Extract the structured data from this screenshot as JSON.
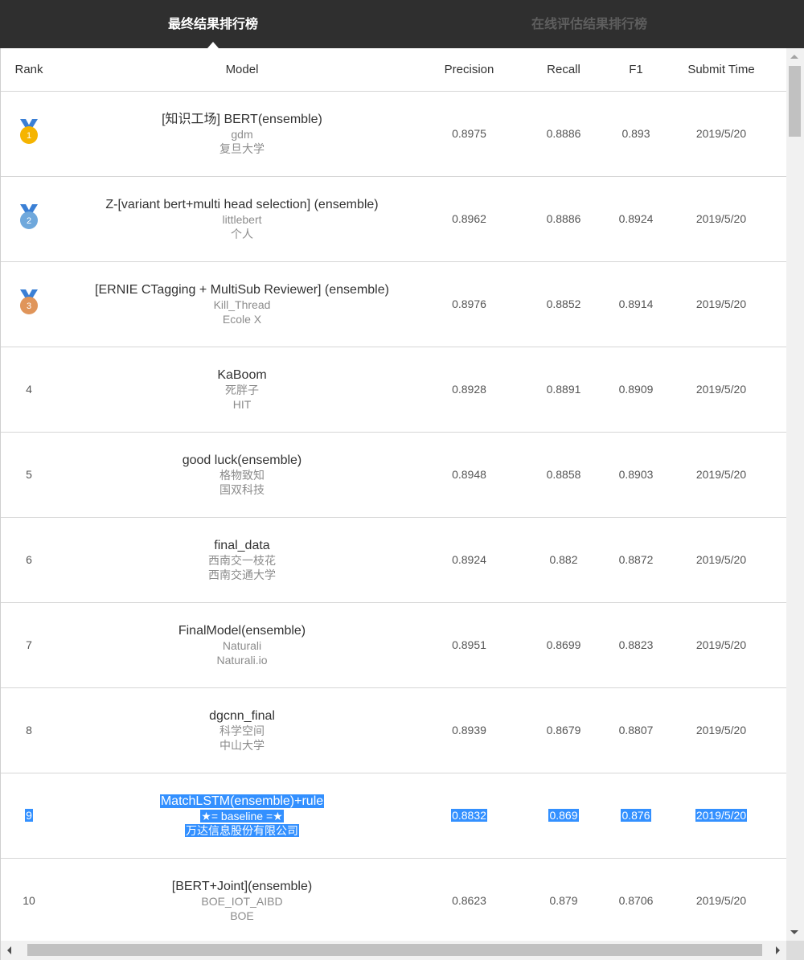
{
  "tabs": {
    "active": "最终结果排行榜",
    "inactive": "在线评估结果排行榜"
  },
  "columns": {
    "rank": "Rank",
    "model": "Model",
    "precision": "Precision",
    "recall": "Recall",
    "f1": "F1",
    "submit_time": "Submit Time"
  },
  "medal_colors": {
    "gold": "#f5b400",
    "silver": "#6fa8dc",
    "bronze": "#e0955a",
    "ribbon": "#3a7fd5"
  },
  "rows": [
    {
      "rank": "1",
      "medal": "gold",
      "model": "[知识工场] BERT(ensemble)",
      "team": "gdm",
      "org": "复旦大学",
      "precision": "0.8975",
      "recall": "0.8886",
      "f1": "0.893",
      "time": "2019/5/20"
    },
    {
      "rank": "2",
      "medal": "silver",
      "model": "Z-[variant bert+multi head selection] (ensemble)",
      "team": "littlebert",
      "org": "个人",
      "precision": "0.8962",
      "recall": "0.8886",
      "f1": "0.8924",
      "time": "2019/5/20"
    },
    {
      "rank": "3",
      "medal": "bronze",
      "model": "[ERNIE CTagging + MultiSub Reviewer] (ensemble)",
      "team": "Kill_Thread",
      "org": "Ecole X",
      "precision": "0.8976",
      "recall": "0.8852",
      "f1": "0.8914",
      "time": "2019/5/20"
    },
    {
      "rank": "4",
      "model": "KaBoom",
      "team": "死胖子",
      "org": "HIT",
      "precision": "0.8928",
      "recall": "0.8891",
      "f1": "0.8909",
      "time": "2019/5/20"
    },
    {
      "rank": "5",
      "model": "good luck(ensemble)",
      "team": "格物致知",
      "org": "国双科技",
      "precision": "0.8948",
      "recall": "0.8858",
      "f1": "0.8903",
      "time": "2019/5/20"
    },
    {
      "rank": "6",
      "model": "final_data",
      "team": "西南交一枝花",
      "org": "西南交通大学",
      "precision": "0.8924",
      "recall": "0.882",
      "f1": "0.8872",
      "time": "2019/5/20"
    },
    {
      "rank": "7",
      "model": "FinalModel(ensemble)",
      "team": "Naturali",
      "org": "Naturali.io",
      "precision": "0.8951",
      "recall": "0.8699",
      "f1": "0.8823",
      "time": "2019/5/20"
    },
    {
      "rank": "8",
      "model": "dgcnn_final",
      "team": "科学空间",
      "org": "中山大学",
      "precision": "0.8939",
      "recall": "0.8679",
      "f1": "0.8807",
      "time": "2019/5/20"
    },
    {
      "rank": "9",
      "model": "MatchLSTM(ensemble)+rule",
      "team": "★= baseline =★",
      "org": "万达信息股份有限公司",
      "precision": "0.8832",
      "recall": "0.869",
      "f1": "0.876",
      "time": "2019/5/20"
    },
    {
      "rank": "10",
      "model": "[BERT+Joint](ensemble)",
      "team": "BOE_IOT_AIBD",
      "org": "BOE",
      "precision": "0.8623",
      "recall": "0.879",
      "f1": "0.8706",
      "time": "2019/5/20"
    }
  ]
}
